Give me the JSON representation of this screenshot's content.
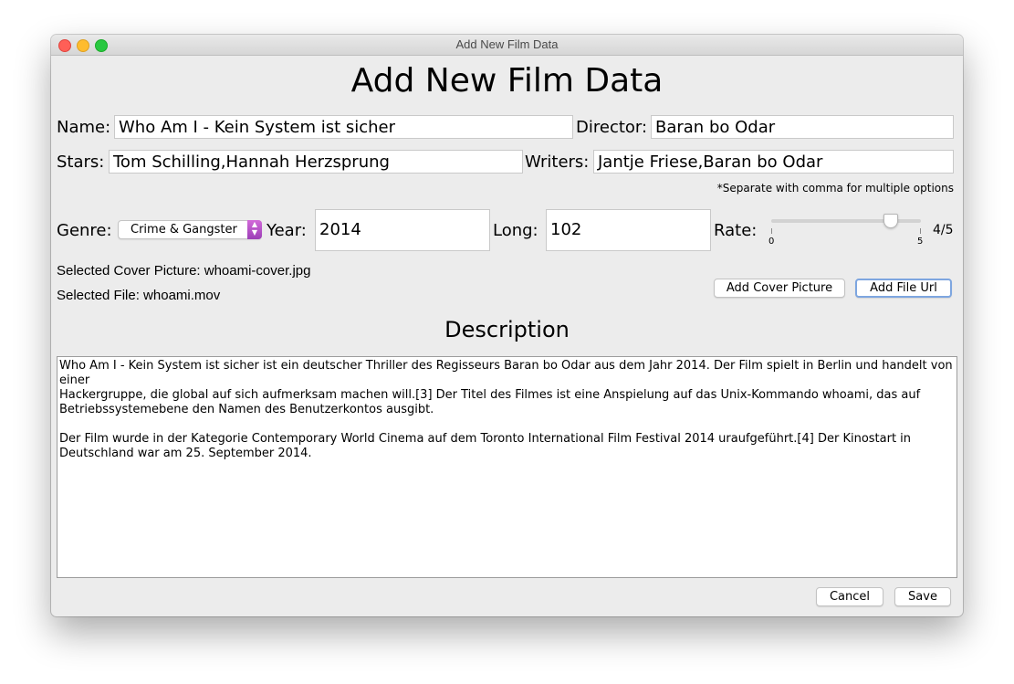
{
  "window": {
    "title": "Add New Film Data"
  },
  "heading": "Add New Film Data",
  "fields": {
    "name": {
      "label": "Name:",
      "value": "Who Am I - Kein System ist sicher"
    },
    "director": {
      "label": "Director:",
      "value": "Baran bo Odar"
    },
    "stars": {
      "label": "Stars:",
      "value": "Tom Schilling,Hannah Herzsprung"
    },
    "writers": {
      "label": "Writers:",
      "value": "Jantje Friese,Baran bo Odar"
    },
    "note": "*Separate with comma for multiple options",
    "genre": {
      "label": "Genre:",
      "selected": "Crime & Gangster"
    },
    "year": {
      "label": "Year:",
      "value": "2014"
    },
    "long": {
      "label": "Long:",
      "value": "102"
    },
    "rate": {
      "label": "Rate:",
      "value": 4,
      "min": 0,
      "max": 5,
      "min_label": "0",
      "max_label": "5",
      "display": "4/5"
    }
  },
  "selection": {
    "cover": "Selected Cover Picture: whoami-cover.jpg",
    "file": "Selected File: whoami.mov"
  },
  "buttons": {
    "add_cover": "Add Cover Picture",
    "add_file": "Add File Url",
    "cancel": "Cancel",
    "save": "Save"
  },
  "description": {
    "title": "Description",
    "text": "Who Am I - Kein System ist sicher ist ein deutscher Thriller des Regisseurs Baran bo Odar aus dem Jahr 2014. Der Film spielt in Berlin und handelt von einer\nHackergruppe, die global auf sich aufmerksam machen will.[3] Der Titel des Filmes ist eine Anspielung auf das Unix-Kommando whoami, das auf\nBetriebssystemebene den Namen des Benutzerkontos ausgibt.\n\nDer Film wurde in der Kategorie Contemporary World Cinema auf dem Toronto International Film Festival 2014 uraufgeführt.[4] Der Kinostart in\nDeutschland war am 25. September 2014."
  },
  "colors": {
    "window_bg": "#ececec",
    "focus_ring": "#7ea6e0",
    "select_accent": "#b04fc6"
  }
}
